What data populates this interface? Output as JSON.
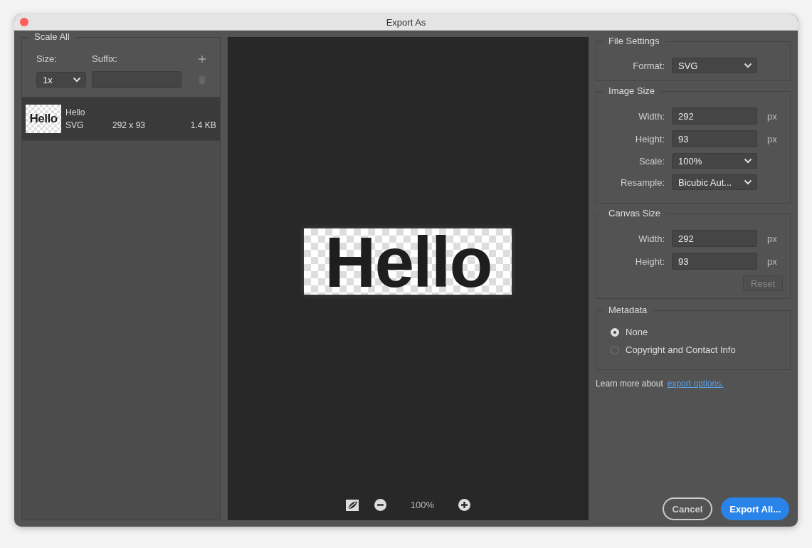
{
  "window": {
    "title": "Export As"
  },
  "scale_all": {
    "title": "Scale All",
    "size_label": "Size:",
    "suffix_label": "Suffix:",
    "size_value": "1x"
  },
  "assets": [
    {
      "name": "Hello",
      "format": "SVG",
      "dimensions": "292 x 93",
      "file_size": "1.4 KB",
      "thumbnail_text": "Hello",
      "selected": true
    }
  ],
  "preview": {
    "artwork_text": "Hello",
    "zoom": "100%"
  },
  "file_settings": {
    "title": "File Settings",
    "format_label": "Format:",
    "format_value": "SVG"
  },
  "image_size": {
    "title": "Image Size",
    "fields": [
      {
        "kind": "input",
        "label": "Width:",
        "value": "292",
        "unit": "px"
      },
      {
        "kind": "input",
        "label": "Height:",
        "value": "93",
        "unit": "px"
      },
      {
        "kind": "select",
        "label": "Scale:",
        "value": "100%"
      },
      {
        "kind": "select",
        "label": "Resample:",
        "value": "Bicubic Aut..."
      }
    ]
  },
  "canvas_size": {
    "title": "Canvas Size",
    "fields": [
      {
        "kind": "input",
        "label": "Width:",
        "value": "292",
        "unit": "px"
      },
      {
        "kind": "input",
        "label": "Height:",
        "value": "93",
        "unit": "px"
      }
    ],
    "reset": {
      "label": "Reset",
      "disabled": true
    }
  },
  "metadata": {
    "title": "Metadata",
    "options": [
      {
        "label": "None",
        "selected": true
      },
      {
        "label": "Copyright and Contact Info",
        "selected": false
      }
    ]
  },
  "learn_more": {
    "text": "Learn more about",
    "link": "export options."
  },
  "buttons": [
    {
      "kind": "secondary",
      "label": "Cancel"
    },
    {
      "kind": "primary",
      "label": "Export All..."
    }
  ]
}
